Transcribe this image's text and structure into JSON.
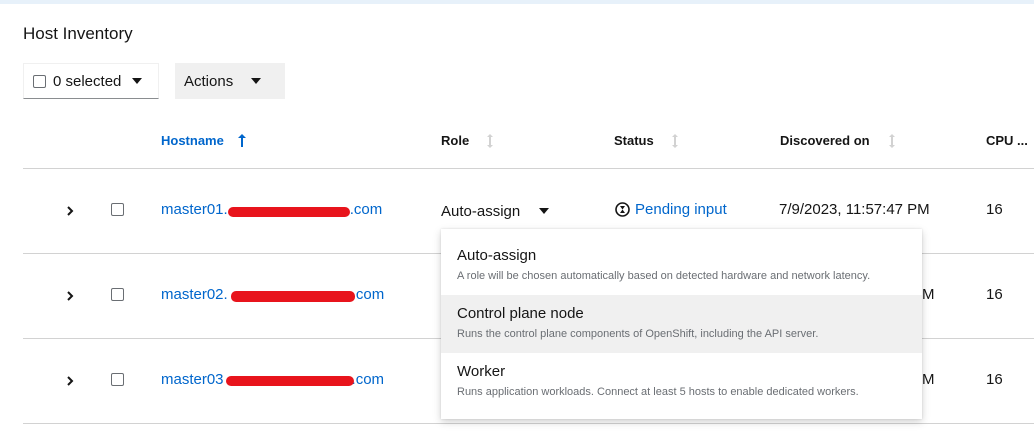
{
  "page": {
    "title": "Host Inventory"
  },
  "toolbar": {
    "bulk_select_label": "0 selected",
    "actions_label": "Actions"
  },
  "table": {
    "columns": {
      "hostname": "Hostname",
      "role": "Role",
      "status": "Status",
      "discovered_on": "Discovered on",
      "cpu": "CPU ..."
    },
    "rows": [
      {
        "hostname_prefix": "master01.",
        "hostname_suffix": ".com",
        "role": "Auto-assign",
        "status": "Pending input",
        "discovered": "7/9/2023, 11:57:47 PM",
        "cpu": "16"
      },
      {
        "hostname_prefix": "master02.",
        "hostname_suffix": ".com",
        "discovered_tail": "M",
        "cpu": "16"
      },
      {
        "hostname_prefix": "master03",
        "hostname_suffix": ".com",
        "discovered_tail": "M",
        "cpu": "16"
      }
    ]
  },
  "role_menu": {
    "items": [
      {
        "title": "Auto-assign",
        "description": "A role will be chosen automatically based on detected hardware and network latency."
      },
      {
        "title": "Control plane node",
        "description": "Runs the control plane components of OpenShift, including the API server."
      },
      {
        "title": "Worker",
        "description": "Runs application workloads. Connect at least 5 hosts to enable dedicated workers."
      }
    ]
  },
  "colors": {
    "link": "#0066cc",
    "redaction": "#e8141c",
    "hover_bg": "#f0f0f0"
  }
}
